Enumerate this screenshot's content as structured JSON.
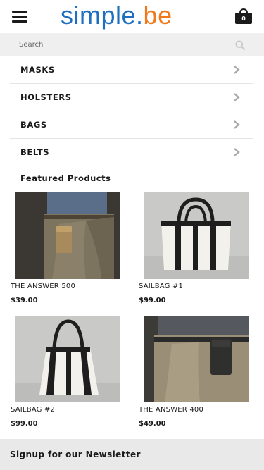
{
  "header": {
    "logo": {
      "main": "simple",
      "dot": ".",
      "tld": "be"
    },
    "cart_count": "0",
    "colors": {
      "logo_blue": "#1f6fc0",
      "logo_orange": "#f07a1a"
    }
  },
  "search": {
    "placeholder": "Search"
  },
  "categories": [
    {
      "label": "MASKS",
      "icon": "chevron-right-icon"
    },
    {
      "label": "HOLSTERS",
      "icon": "chevron-right-icon"
    },
    {
      "label": "BAGS",
      "icon": "chevron-right-icon"
    },
    {
      "label": "BELTS",
      "icon": "chevron-right-icon"
    }
  ],
  "featured": {
    "title": "Featured Products",
    "products": [
      {
        "name": "THE ANSWER 500",
        "price": "$39.00"
      },
      {
        "name": "SAILBAG #1",
        "price": "$99.00"
      },
      {
        "name": "SAILBAG #2",
        "price": "$99.00"
      },
      {
        "name": "THE ANSWER 400",
        "price": "$49.00"
      }
    ]
  },
  "newsletter": {
    "title": "Signup for our Newsletter"
  }
}
